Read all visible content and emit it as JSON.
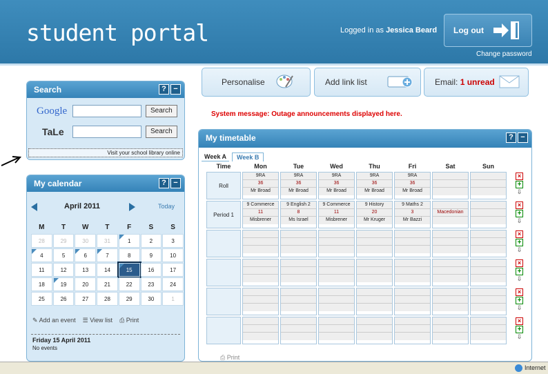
{
  "header": {
    "logo": "student portal",
    "logged_prefix": "Logged in as",
    "user": "Jessica Beard",
    "logout": "Log out",
    "change_password": "Change password"
  },
  "search": {
    "title": "Search",
    "google": "Google",
    "tale": "TaLe",
    "search_label": "Search",
    "library_link": "Visit your school library online"
  },
  "calendar": {
    "title": "My calendar",
    "month": "April 2011",
    "today": "Today",
    "days": [
      "M",
      "T",
      "W",
      "T",
      "F",
      "S",
      "S"
    ],
    "weeks": [
      [
        "28",
        "29",
        "30",
        "31",
        "1",
        "2",
        "3"
      ],
      [
        "4",
        "5",
        "6",
        "7",
        "8",
        "9",
        "10"
      ],
      [
        "11",
        "12",
        "13",
        "14",
        "15",
        "16",
        "17"
      ],
      [
        "18",
        "19",
        "20",
        "21",
        "22",
        "23",
        "24"
      ],
      [
        "25",
        "26",
        "27",
        "28",
        "29",
        "30",
        "1"
      ]
    ],
    "add_event": "Add an event",
    "view_list": "View list",
    "print": "Print",
    "date_heading": "Friday 15 April 2011",
    "no_events": "No events"
  },
  "toptabs": {
    "personalise": "Personalise",
    "add_link": "Add link list",
    "email_prefix": "Email:",
    "email_unread": "1 unread"
  },
  "system_message": "System message: Outage announcements displayed here.",
  "timetable": {
    "title": "My timetable",
    "tabs": [
      "Week A",
      "Week B"
    ],
    "headers": [
      "Time",
      "Mon",
      "Tue",
      "Wed",
      "Thu",
      "Fri",
      "Sat",
      "Sun"
    ],
    "rows": [
      {
        "label": "Roll",
        "cells": [
          [
            "9RA",
            "36",
            "Mr Broad"
          ],
          [
            "9RA",
            "36",
            "Mr Broad"
          ],
          [
            "9RA",
            "36",
            "Mr Broad"
          ],
          [
            "9RA",
            "36",
            "Mr Broad"
          ],
          [
            "9RA",
            "36",
            "Mr Broad"
          ],
          [],
          []
        ]
      },
      {
        "label": "Period 1",
        "cells": [
          [
            "9 Commerce",
            "11",
            "Misbrener"
          ],
          [
            "9 English 2",
            "8",
            "Ms Israel"
          ],
          [
            "9 Commerce",
            "11",
            "Misbrener"
          ],
          [
            "9 History",
            "20",
            "Mr Kruger"
          ],
          [
            "9 Maths 2",
            "3",
            "Mr Bazzi"
          ],
          [
            "",
            "Macedonian",
            ""
          ],
          []
        ]
      },
      {
        "label": "",
        "cells": [
          [],
          [],
          [],
          [],
          [],
          [],
          []
        ]
      },
      {
        "label": "",
        "cells": [
          [],
          [],
          [],
          [],
          [],
          [],
          []
        ]
      },
      {
        "label": "",
        "cells": [
          [],
          [],
          [],
          [],
          [],
          [],
          []
        ]
      },
      {
        "label": "",
        "cells": [
          [],
          [],
          [],
          [],
          [],
          [],
          []
        ]
      }
    ],
    "print": "Print"
  },
  "statusbar": {
    "zone": "Internet"
  }
}
